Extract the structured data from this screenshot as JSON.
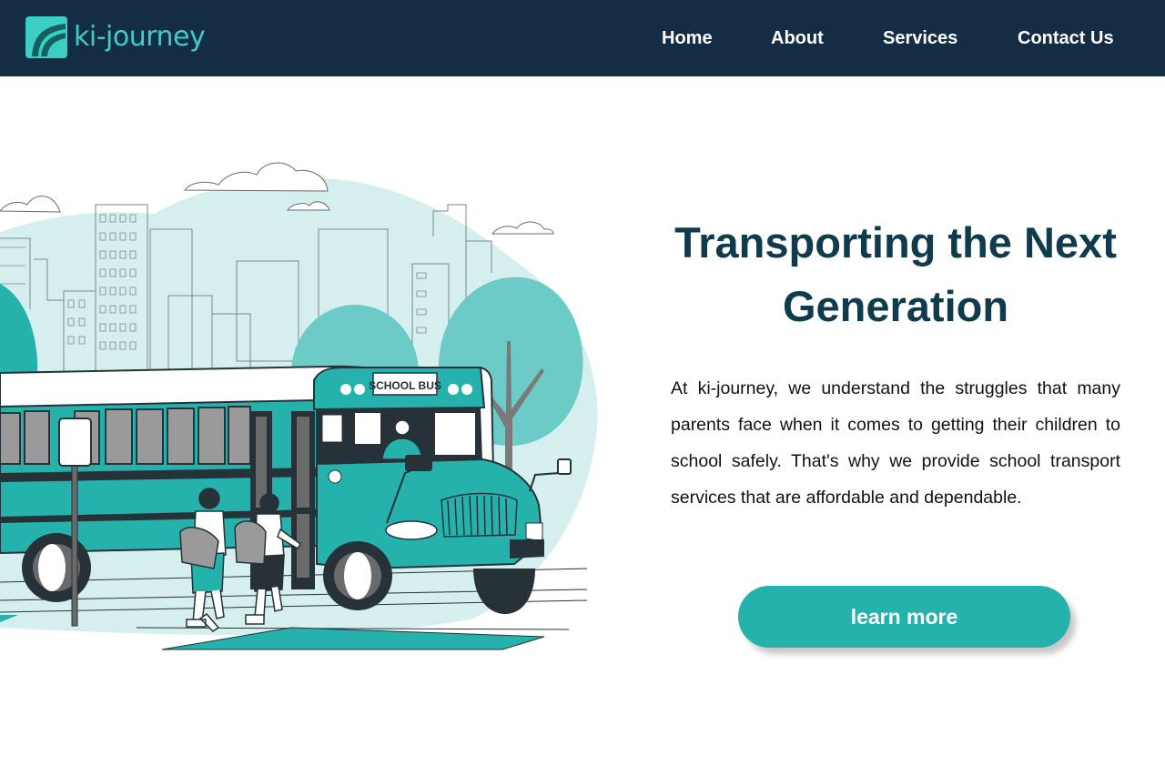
{
  "brand": {
    "name": "ki-journey",
    "accent": "#3ccdc5",
    "navbar_bg": "#152d44"
  },
  "nav": {
    "items": [
      {
        "label": "Home"
      },
      {
        "label": "About"
      },
      {
        "label": "Services"
      },
      {
        "label": "Contact Us"
      }
    ]
  },
  "hero": {
    "title": "Transporting the Next Generation",
    "body": "At ki-journey, we understand the struggles that many parents face when it comes to getting their children to school safely. That's why we provide school transport services that are affordable and dependable.",
    "cta_label": "learn more",
    "title_color": "#0f3b4d",
    "cta_color": "#26b2ac"
  },
  "illustration": {
    "subject": "school-bus-illustration",
    "bus_sign": "SCHOOL BUS",
    "colors": {
      "teal": "#26b2ac",
      "light_teal": "#d4efee",
      "tree_teal": "#6ccbc6",
      "dark": "#263238",
      "gray": "#6a6a6a"
    }
  }
}
